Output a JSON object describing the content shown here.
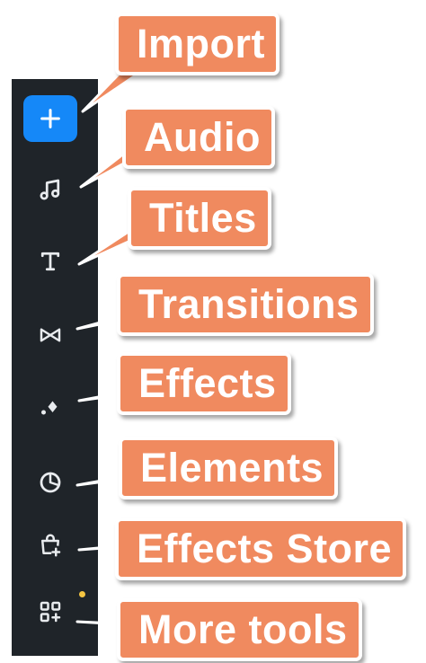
{
  "colors": {
    "toolbar_bg": "#1f2429",
    "import_accent": "#1588f8",
    "callout_fill": "#f08a5f",
    "callout_border": "#ffffff",
    "notification_dot": "#f5c542"
  },
  "toolbar": {
    "import_icon": "plus-icon",
    "audio_icon": "music-note-icon",
    "titles_icon": "text-t-icon",
    "transitions_icon": "bowtie-icon",
    "effects_icon": "sparkle-icon",
    "elements_icon": "pie-icon",
    "store_icon": "shopping-bag-plus-icon",
    "more_icon": "grid-plus-icon"
  },
  "callouts": {
    "import": "Import",
    "audio": "Audio",
    "titles": "Titles",
    "transitions": "Transitions",
    "effects": "Effects",
    "elements": "Elements",
    "effects_store": "Effects Store",
    "more_tools": "More tools"
  }
}
